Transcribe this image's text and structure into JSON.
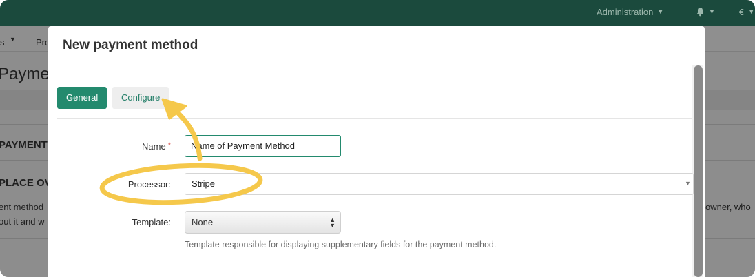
{
  "topbar": {
    "admin_label": "Administration",
    "bell_icon": "bell-icon",
    "currency_label": "€"
  },
  "background": {
    "subnav_item_1": "s",
    "subnav_item_2": "Pro",
    "page_title": "Paymen",
    "section_heading": "PAYMENT M",
    "place_heading": "PLACE OV",
    "body_line_1": "ent method",
    "body_line_2": "out it and w",
    "right_text": "owner, who"
  },
  "modal": {
    "title": "New payment method",
    "tabs": [
      {
        "label": "General",
        "active": true
      },
      {
        "label": "Configure",
        "active": false
      }
    ],
    "form": {
      "name_label": "Name",
      "required_mark": "*",
      "name_value": "Name of Payment Method",
      "processor_label": "Processor:",
      "processor_value": "Stripe",
      "template_label": "Template:",
      "template_value": "None",
      "template_help": "Template responsible for displaying supplementary fields for the payment method."
    }
  },
  "colors": {
    "brand_dark": "#1b4a3d",
    "accent": "#238a6e",
    "annotation": "#f5c84b"
  }
}
